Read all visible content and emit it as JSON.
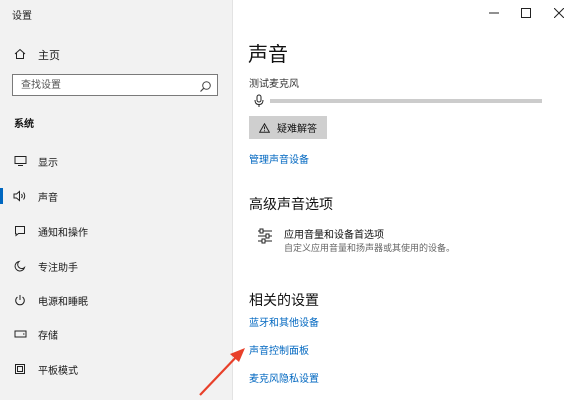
{
  "window": {
    "title": "设置"
  },
  "sidebar": {
    "home_label": "主页",
    "search_placeholder": "查找设置",
    "section_header": "系统",
    "items": [
      {
        "label": "显示",
        "icon": "monitor-icon"
      },
      {
        "label": "声音",
        "icon": "speaker-icon",
        "selected": true
      },
      {
        "label": "通知和操作",
        "icon": "notification-icon"
      },
      {
        "label": "专注助手",
        "icon": "moon-icon"
      },
      {
        "label": "电源和睡眠",
        "icon": "power-icon"
      },
      {
        "label": "存储",
        "icon": "storage-icon"
      },
      {
        "label": "平板模式",
        "icon": "tablet-icon"
      }
    ]
  },
  "main": {
    "title": "声音",
    "mic_test_label": "测试麦克风",
    "mic_level": 0,
    "troubleshoot_label": "疑难解答",
    "manage_devices_link": "管理声音设备",
    "advanced": {
      "title": "高级声音选项",
      "item_title": "应用音量和设备首选项",
      "item_desc": "自定义应用音量和扬声器或其使用的设备。"
    },
    "related": {
      "title": "相关的设置",
      "links": [
        "蓝牙和其他设备",
        "声音控制面板",
        "麦克风隐私设置"
      ]
    }
  },
  "colors": {
    "accent": "#0067c0",
    "sidebar_bg": "#f2f2f2",
    "annotation_arrow": "#e8402a"
  }
}
